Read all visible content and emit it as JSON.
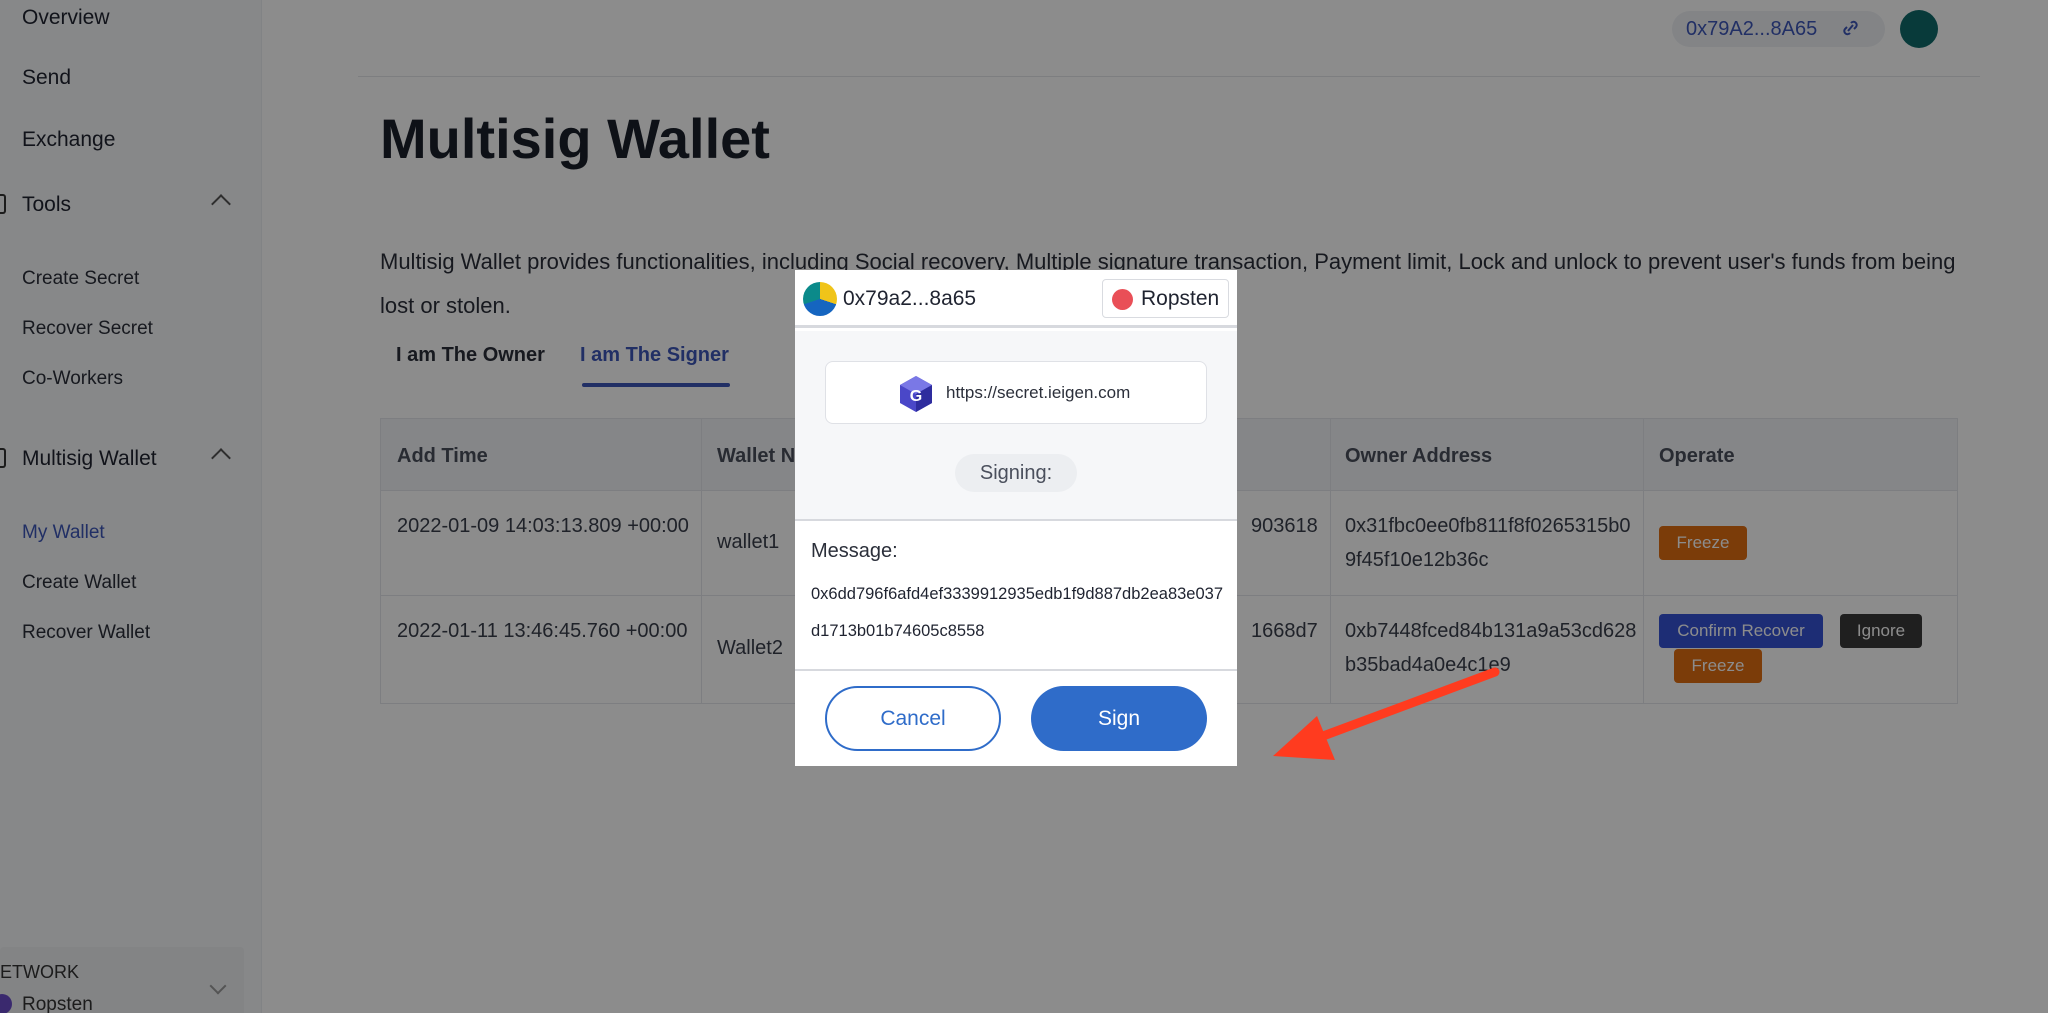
{
  "sidebar": {
    "items": [
      {
        "label": "Overview"
      },
      {
        "label": "Send"
      },
      {
        "label": "Exchange"
      },
      {
        "label": "Tools"
      },
      {
        "label": "Multisig Wallet"
      }
    ],
    "tools_sub": [
      "Create Secret",
      "Recover Secret",
      "Co-Workers"
    ],
    "multisig_sub": [
      "My Wallet",
      "Create Wallet",
      "Recover Wallet"
    ],
    "network_label": "ETWORK",
    "network_value": "Ropsten"
  },
  "header": {
    "address": "0x79A2...8A65"
  },
  "main": {
    "title": "Multisig Wallet",
    "description": "Multisig Wallet provides functionalities, including Social recovery, Multiple signature transaction, Payment limit, Lock and unlock to prevent user's funds from being lost or stolen.",
    "tabs": [
      "I am The Owner",
      "I am The Signer"
    ],
    "active_tab": "I am The Signer",
    "table": {
      "columns": [
        "Add Time",
        "Wallet N",
        "Owner Address",
        "Operate"
      ],
      "rows": [
        {
          "add_time": "2022-01-09 14:03:13.809 +00:00",
          "wallet": "wallet1",
          "partial_address": "903618",
          "owner_address": "0x31fbc0ee0fb811f8f0265315b09f45f10e12b36c",
          "actions": [
            "Freeze"
          ]
        },
        {
          "add_time": "2022-01-11 13:46:45.760 +00:00",
          "wallet": "Wallet2",
          "partial_address": "1668d7",
          "owner_address": "0xb7448fced84b131a9a53cd628b35bad4a0e4c1e9",
          "actions": [
            "Confirm Recover",
            "Ignore",
            "Freeze"
          ]
        }
      ]
    }
  },
  "modal": {
    "account": "0x79a2...8a65",
    "network": "Ropsten",
    "site_url": "https://secret.ieigen.com",
    "status": "Signing:",
    "message_label": "Message:",
    "message": "0x6dd796f6afd4ef3339912935edb1f9d887db2ea83e037d1713b01b74605c8558",
    "cancel_label": "Cancel",
    "sign_label": "Sign"
  },
  "colors": {
    "accent": "#3d57b8",
    "sign_button": "#2f6cc9",
    "freeze": "#e06d12",
    "confirm_recover": "#3553d6",
    "arrow": "#ff3b1f"
  }
}
